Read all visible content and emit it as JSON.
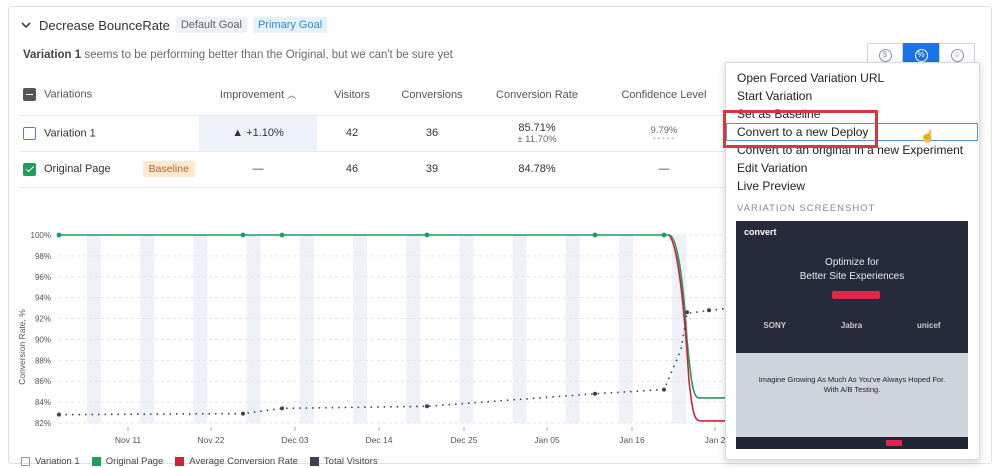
{
  "goal": {
    "title": "Decrease BounceRate",
    "tags": [
      "Default Goal",
      "Primary Goal"
    ]
  },
  "status": {
    "bold": "Variation 1",
    "rest": " seems to be performing better than the Original, but we can't be sure yet"
  },
  "metric_toggle": [
    "dollar-icon",
    "percent-icon",
    "person-icon"
  ],
  "table": {
    "headers": [
      "Variations",
      "Improvement",
      "Visitors",
      "Conversions",
      "Conversion Rate",
      "Confidence Level"
    ],
    "rows": [
      {
        "name": "Variation 1",
        "improvement": "▲ +1.10%",
        "visitors": "42",
        "conversions": "36",
        "rate": "85.71%",
        "rate_sub": "± 11.70%",
        "confidence": "9.79%",
        "checked": false
      },
      {
        "name": "Original Page",
        "badge": "Baseline",
        "improvement": "—",
        "visitors": "46",
        "conversions": "39",
        "rate": "84.78%",
        "confidence": "—",
        "checked": true
      }
    ]
  },
  "chart_data": {
    "type": "line",
    "ylabel": "Conversion Rate, %",
    "yticks": [
      "100%",
      "98%",
      "96%",
      "94%",
      "92%",
      "90%",
      "88%",
      "86%",
      "84%",
      "82%"
    ],
    "ylim": [
      82,
      100
    ],
    "xticks": [
      "Nov 11",
      "Nov 22",
      "Dec 03",
      "Dec 14",
      "Dec 25",
      "Jan 05",
      "Jan 16",
      "Jan 2"
    ],
    "series": [
      {
        "name": "Original Page",
        "color": "#1e9e5c"
      },
      {
        "name": "Average Conversion Rate",
        "color": "#d0213a"
      },
      {
        "name": "Total Visitors",
        "color": "#3d3f55"
      }
    ]
  },
  "legend": [
    {
      "label": "Variation 1",
      "color": "#ffffff"
    },
    {
      "label": "Original Page",
      "color": "#1e9e5c"
    },
    {
      "label": "Average Conversion Rate",
      "color": "#d0213a"
    },
    {
      "label": "Total Visitors",
      "color": "#3d3f55"
    }
  ],
  "menu": {
    "items": [
      "Open Forced Variation URL",
      "Start Variation",
      "Set as Baseline",
      "Convert to a new Deploy",
      "Convert to an original in a new Experiment",
      "Edit Variation",
      "Live Preview"
    ],
    "screenshot_title": "VARIATION SCREENSHOT",
    "screenshot": {
      "logo": "convert",
      "headline1": "Optimize for",
      "headline2": "Better Site Experiences",
      "brands": [
        "SONY",
        "Jabra",
        "unicef"
      ],
      "headline3": "Imagine Growing As Much As You've Always Hoped For.",
      "headline4": "With A/B Testing."
    }
  }
}
